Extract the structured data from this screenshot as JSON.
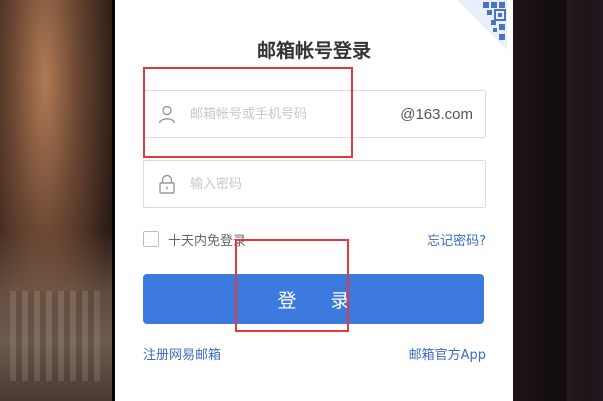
{
  "login": {
    "title": "邮箱帐号登录",
    "username": {
      "placeholder": "邮箱帐号或手机号码",
      "suffix": "@163.com",
      "icon": "user-icon"
    },
    "password": {
      "placeholder": "输入密码",
      "icon": "lock-icon"
    },
    "remember_label": "十天内免登录",
    "forgot_label": "忘记密码?",
    "submit_label": "登 录",
    "register_label": "注册网易邮箱",
    "app_label": "邮箱官方App"
  },
  "colors": {
    "accent": "#3d7ae0",
    "link": "#3b6bc1",
    "highlight": "#e33b3b",
    "qr": "#4a73c4"
  }
}
